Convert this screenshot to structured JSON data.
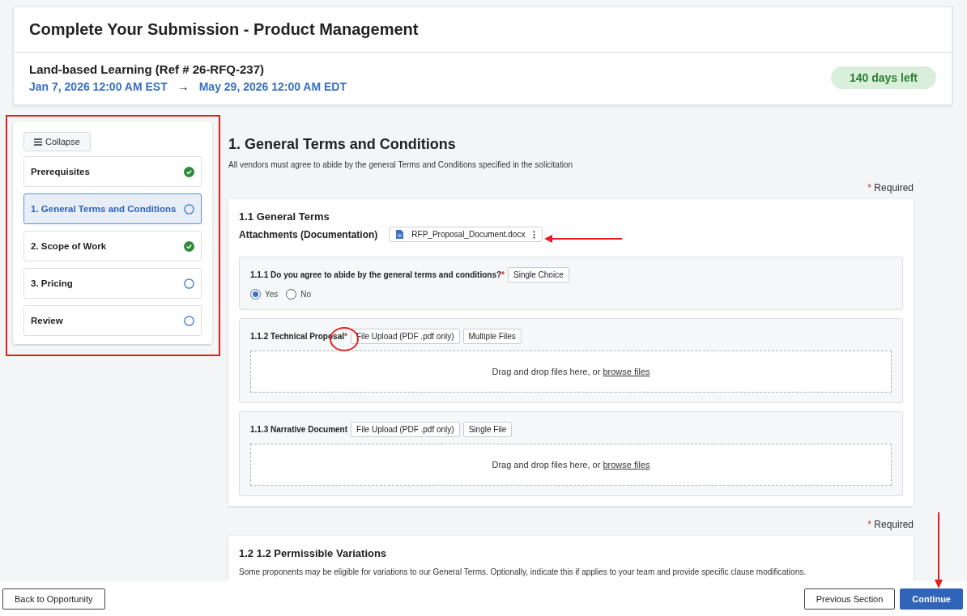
{
  "header": {
    "title": "Complete Your Submission - Product Management",
    "opportunity": "Land-based Learning (Ref # 26-RFQ-237)",
    "start": "Jan 7, 2026 12:00 AM EST",
    "arrow": "→",
    "end": "May 29, 2026 12:00 AM EDT",
    "days_left": "140 days left"
  },
  "sidebar": {
    "collapse_label": "Collapse",
    "items": [
      {
        "label": "Prerequisites",
        "complete": true,
        "selected": false
      },
      {
        "label": "1. General Terms and Conditions",
        "complete": false,
        "selected": true
      },
      {
        "label": "2. Scope of Work",
        "complete": true,
        "selected": false
      },
      {
        "label": "3. Pricing",
        "complete": false,
        "selected": false
      },
      {
        "label": "Review",
        "complete": false,
        "selected": false
      }
    ]
  },
  "section": {
    "title": "1. General Terms and Conditions",
    "description": "All vendors must agree to abide by the general Terms and Conditions specified in the solicitation",
    "required_mark": "*",
    "required_note": "Required",
    "card": {
      "title": "1.1 General Terms",
      "attachments_label": "Attachments (Documentation)",
      "attachment": "RFP_Proposal_Document.docx",
      "questions": [
        {
          "kind": "choice",
          "label": "1.1.1 Do you agree to abide by the general terms and conditions?",
          "required": true,
          "tags": [
            "Single Choice"
          ],
          "options": [
            {
              "label": "Yes",
              "selected": true
            },
            {
              "label": "No",
              "selected": false
            }
          ]
        },
        {
          "kind": "upload",
          "label": "1.1.2 Technical Proposal",
          "required": true,
          "tags": [
            "File Upload (PDF .pdf only)",
            "Multiple Files"
          ],
          "drop_text": "Drag and drop files here, or ",
          "drop_link": "browse files"
        },
        {
          "kind": "upload",
          "label": "1.1.3 Narrative Document",
          "required": false,
          "tags": [
            "File Upload (PDF .pdf only)",
            "Single File"
          ],
          "drop_text": "Drag and drop files here, or ",
          "drop_link": "browse files"
        }
      ]
    }
  },
  "next_section": {
    "required_mark": "*",
    "required_note": "Required",
    "title": "1.2 1.2 Permissible Variations",
    "description": "Some proponents may be eligible for variations to our General Terms. Optionally, indicate this if applies to your team and provide specific clause modifications."
  },
  "footer": {
    "back": "Back to Opportunity",
    "previous": "Previous Section",
    "continue": "Continue"
  }
}
